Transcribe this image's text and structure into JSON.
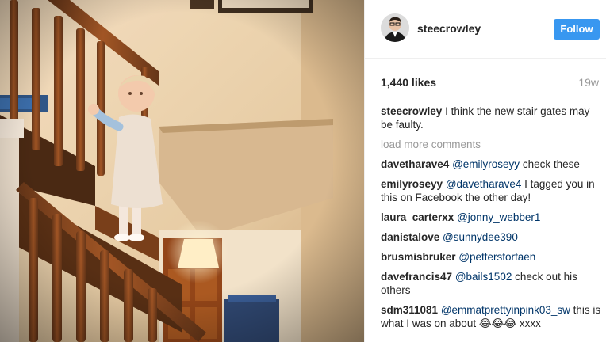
{
  "post": {
    "username": "steecrowley",
    "follow_label": "Follow",
    "likes": "1,440 likes",
    "age": "19w",
    "caption": {
      "user": "steecrowley",
      "text": "I think the new stair gates may be faulty."
    },
    "load_more": "load more comments",
    "comments": [
      {
        "user": "davetharave4",
        "mention": "@emilyroseyy",
        "text": "check these"
      },
      {
        "user": "emilyroseyy",
        "mention": "@davetharave4",
        "text": "I tagged you in this on Facebook the other day!"
      },
      {
        "user": "laura_carterxx",
        "mention": "@jonny_webber1",
        "text": ""
      },
      {
        "user": "danistalove",
        "mention": "@sunnydee390",
        "text": ""
      },
      {
        "user": "brusmisbruker",
        "mention": "@pettersforfaen",
        "text": ""
      },
      {
        "user": "davefrancis47",
        "mention": "@bails1502",
        "text": "check out his others"
      },
      {
        "user": "sdm311081",
        "mention": "@emmatprettyinpink03_sw",
        "text": "this is what I was on about 😂😂😂 xxxx"
      }
    ]
  },
  "icons": {
    "avatar": "profile-photo"
  },
  "colors": {
    "follow_button": "#3897f0",
    "mention": "#003569",
    "muted": "#999999",
    "text": "#262626"
  }
}
